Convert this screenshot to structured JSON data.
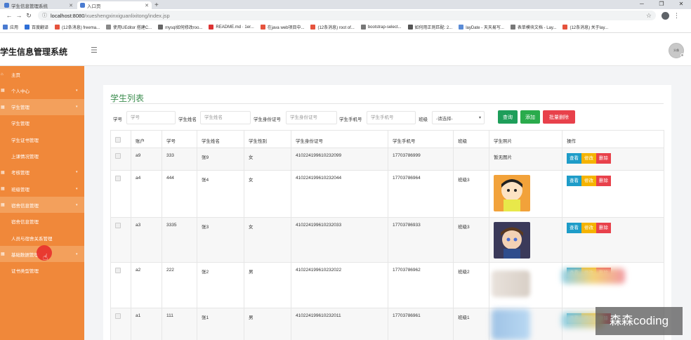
{
  "browser": {
    "tabs": [
      {
        "title": "学生信息管理系统",
        "active": false
      },
      {
        "title": "入口页",
        "active": true
      }
    ],
    "new_tab": "+",
    "url_host": "localhost:8080",
    "url_path": "/xueshengxinxiguanlixitong/index.jsp",
    "bookmarks": [
      {
        "label": "应用",
        "color": "#4a7bd0"
      },
      {
        "label": "百度翻译",
        "color": "#2f6fd6"
      },
      {
        "label": "(12条消息) freema...",
        "color": "#e5533d"
      },
      {
        "label": "使用UEditor 搭建C...",
        "color": "#888888"
      },
      {
        "label": "mysql如何修改roo...",
        "color": "#666666"
      },
      {
        "label": "README.md · 1er...",
        "color": "#d33"
      },
      {
        "label": "在java web项目中...",
        "color": "#e5533d"
      },
      {
        "label": "(12条消息) root of...",
        "color": "#e5533d"
      },
      {
        "label": "bootstrap-select...",
        "color": "#777777"
      },
      {
        "label": "如何用正则匹配: 2...",
        "color": "#555555"
      },
      {
        "label": "layDate - 天天易写...",
        "color": "#5a8bd6"
      },
      {
        "label": "表单模块文档 - Lay...",
        "color": "#777777"
      },
      {
        "label": "(12条消息) 关于lay...",
        "color": "#e5533d"
      }
    ]
  },
  "app": {
    "brand": "学生信息管理系统",
    "avatar_text": "头像"
  },
  "sidebar": {
    "items": [
      {
        "label": "主页",
        "kind": "parent",
        "icon": "⌂"
      },
      {
        "label": "个人中心",
        "kind": "parent",
        "icon": "▦",
        "chev": "▾"
      },
      {
        "label": "学生管理",
        "kind": "open",
        "icon": "▦",
        "chev": "▾"
      },
      {
        "label": "学生管理",
        "kind": "child"
      },
      {
        "label": "学生证书管理",
        "kind": "child"
      },
      {
        "label": "上课情况管理",
        "kind": "child"
      },
      {
        "label": "考核管理",
        "kind": "parent",
        "icon": "▦",
        "chev": "▾"
      },
      {
        "label": "班级管理",
        "kind": "parent",
        "icon": "▦",
        "chev": "▾"
      },
      {
        "label": "宿舍信息管理",
        "kind": "open",
        "icon": "▦",
        "chev": "▾"
      },
      {
        "label": "宿舍信息管理",
        "kind": "child"
      },
      {
        "label": "人员与宿舍关系管理",
        "kind": "child"
      },
      {
        "label": "基础数据管理",
        "kind": "open",
        "icon": "▦",
        "chev": "▾"
      },
      {
        "label": "证书类型管理",
        "kind": "child"
      }
    ]
  },
  "main": {
    "title": "学生列表",
    "search": {
      "fields": [
        {
          "label": "学号",
          "placeholder": "学号"
        },
        {
          "label": "学生姓名",
          "placeholder": "学生姓名"
        },
        {
          "label": "学生身份证号",
          "placeholder": "学生身份证号"
        },
        {
          "label": "学生手机号",
          "placeholder": "学生手机号"
        }
      ],
      "class_label": "班级",
      "class_select": "-请选择-",
      "buttons": {
        "query": "查询",
        "add": "添加",
        "batch_delete": "批量删除"
      }
    },
    "table": {
      "headers": [
        "",
        "账户",
        "学号",
        "学生姓名",
        "学生性别",
        "学生身份证号",
        "学生手机号",
        "班级",
        "学生照片",
        "操作"
      ],
      "rows": [
        {
          "account": "a9",
          "no": "333",
          "name": "张9",
          "gender": "女",
          "idcard": "410224199610232099",
          "phone": "17703786999",
          "class": "",
          "photo": "暂无图片"
        },
        {
          "account": "a4",
          "no": "444",
          "name": "张4",
          "gender": "女",
          "idcard": "410224199610232044",
          "phone": "17703786964",
          "class": "班级3",
          "photo": ""
        },
        {
          "account": "a3",
          "no": "3335",
          "name": "张3",
          "gender": "女",
          "idcard": "410224199610232033",
          "phone": "17703786933",
          "class": "班级3",
          "photo": ""
        },
        {
          "account": "a2",
          "no": "222",
          "name": "张2",
          "gender": "男",
          "idcard": "410224199610232022",
          "phone": "17703786962",
          "class": "班级2",
          "photo": ""
        },
        {
          "account": "a1",
          "no": "111",
          "name": "张1",
          "gender": "男",
          "idcard": "410224199610232011",
          "phone": "17703786961",
          "class": "班级1",
          "photo": ""
        }
      ],
      "actions": {
        "view": "查看",
        "edit": "修改",
        "delete": "删除"
      }
    }
  },
  "watermark": "森森coding"
}
